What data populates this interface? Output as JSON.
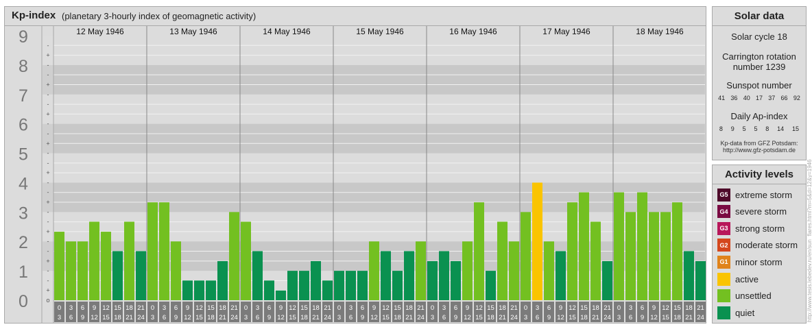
{
  "header": {
    "title": "Kp-index",
    "subtitle": "(planetary 3-hourly index of geomagnetic activity)"
  },
  "chart_data": {
    "type": "bar",
    "title": "Kp-index",
    "subtitle": "(planetary 3-hourly index of geomagnetic activity)",
    "ylim": [
      0,
      9
    ],
    "y_ticks": [
      "0",
      "1",
      "2",
      "3",
      "4",
      "5",
      "6",
      "7",
      "8",
      "9"
    ],
    "sub_ticks": [
      "+",
      "o",
      "-"
    ],
    "days": [
      "12 May 1946",
      "13 May 1946",
      "14 May 1946",
      "15 May 1946",
      "16 May 1946",
      "17 May 1946",
      "18 May 1946"
    ],
    "interval_top": [
      "0",
      "3",
      "6",
      "9",
      "12",
      "15",
      "18",
      "21"
    ],
    "interval_bottom": [
      "3",
      "6",
      "9",
      "12",
      "15",
      "18",
      "21",
      "24"
    ],
    "values": [
      2.33,
      2.0,
      2.0,
      2.67,
      2.33,
      1.67,
      2.67,
      1.67,
      3.33,
      3.33,
      2.0,
      0.67,
      0.67,
      0.67,
      1.33,
      3.0,
      2.67,
      1.67,
      0.67,
      0.33,
      1.0,
      1.0,
      1.33,
      0.67,
      1.0,
      1.0,
      1.0,
      2.0,
      1.67,
      1.0,
      1.67,
      2.0,
      1.33,
      1.67,
      1.33,
      2.0,
      3.33,
      1.0,
      2.67,
      2.0,
      3.0,
      4.0,
      2.0,
      1.67,
      3.33,
      3.67,
      2.67,
      1.33,
      3.67,
      3.0,
      3.67,
      3.0,
      3.0,
      3.33,
      1.67,
      1.33
    ],
    "colors": {
      "quiet": "#0a9150",
      "unsettled": "#73c021",
      "active": "#fac400"
    },
    "grid": true
  },
  "solar": {
    "title": "Solar data",
    "cycle": "Solar cycle 18",
    "carrington_1": "Carrington rotation",
    "carrington_2": "number 1239",
    "sunspot_title": "Sunspot number",
    "sunspot": [
      "41",
      "36",
      "40",
      "17",
      "37",
      "66",
      "92"
    ],
    "ap_title": "Daily Ap-index",
    "ap": [
      "8",
      "9",
      "5",
      "5",
      "8",
      "14",
      "15"
    ],
    "source_1": "Kp-data from GFZ Potsdam:",
    "source_2": "http://www.gfz-potsdam.de"
  },
  "activity": {
    "title": "Activity levels",
    "levels": [
      {
        "code": "G5",
        "label": "extreme storm",
        "color": "#4e0a2a"
      },
      {
        "code": "G4",
        "label": "severe storm",
        "color": "#7a0a42"
      },
      {
        "code": "G3",
        "label": "strong storm",
        "color": "#b8175a"
      },
      {
        "code": "G2",
        "label": "moderate storm",
        "color": "#d4471d"
      },
      {
        "code": "G1",
        "label": "minor storm",
        "color": "#e0831b"
      },
      {
        "code": "",
        "label": "active",
        "color": "#fac400"
      },
      {
        "code": "",
        "label": "unsettled",
        "color": "#73c021"
      },
      {
        "code": "",
        "label": "quiet",
        "color": "#0a9150"
      }
    ]
  },
  "credit": "http://www.tesis.lebedev.ru/en/sun_flares.html?m=5&d=12&y=1946"
}
